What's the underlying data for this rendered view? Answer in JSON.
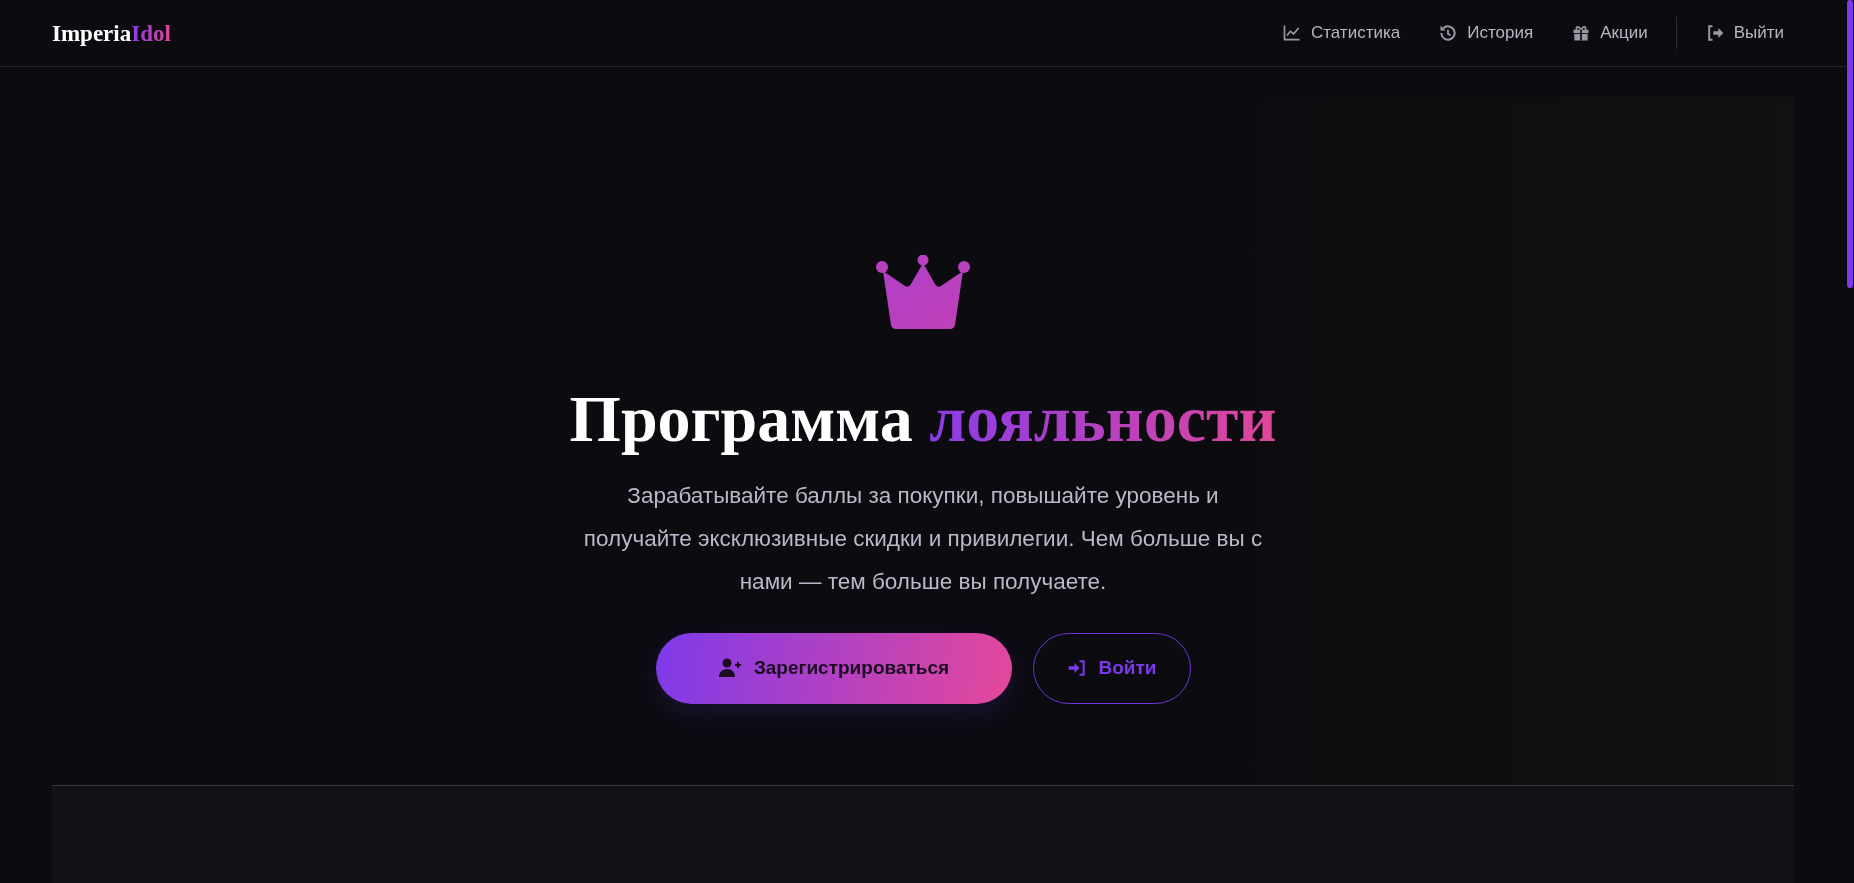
{
  "header": {
    "logo": {
      "main": "Imperia",
      "accent": "Idol"
    },
    "nav": [
      {
        "label": "Статистика"
      },
      {
        "label": "История"
      },
      {
        "label": "Акции"
      }
    ],
    "logout": {
      "label": "Выйти"
    }
  },
  "hero": {
    "title": {
      "main": "Программа",
      "accent": "лояльности"
    },
    "description": "Зарабатывайте баллы за покупки, повышайте уровень и получайте эксклюзивные скидки и привилегии. Чем больше вы с нами — тем больше вы получаете.",
    "buttons": [
      {
        "label": "Зарегистрироваться",
        "kind": "primary"
      },
      {
        "label": "Войти",
        "kind": "outline"
      }
    ]
  }
}
